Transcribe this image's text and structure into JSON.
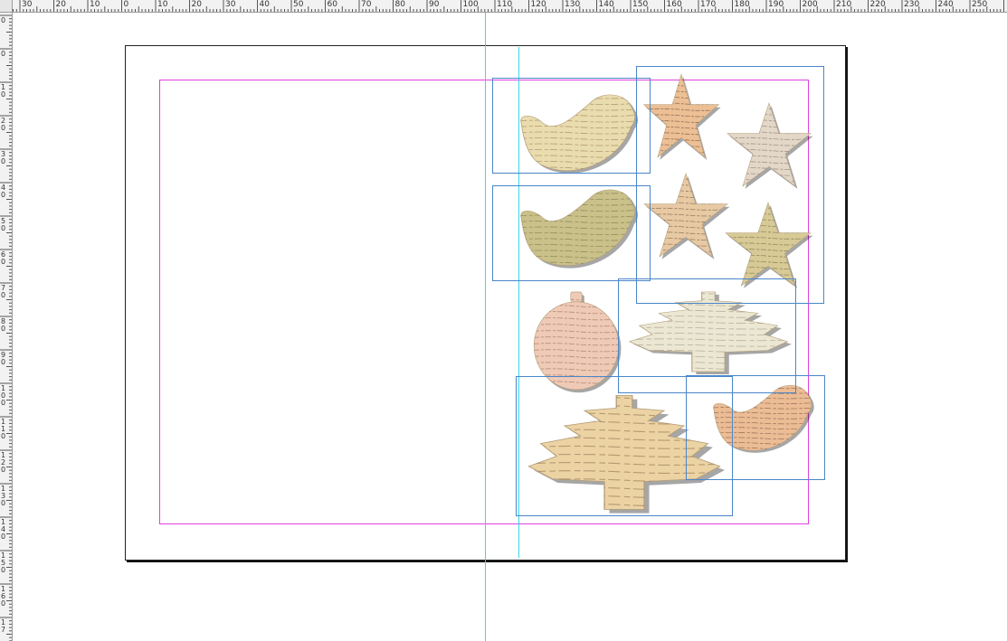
{
  "rulers": {
    "horizontal": {
      "labels": [
        "30",
        "20",
        "10",
        "0",
        "10",
        "20",
        "30",
        "40",
        "50",
        "60",
        "70",
        "80",
        "90",
        "100",
        "110",
        "120",
        "130",
        "140",
        "150",
        "160",
        "170",
        "180",
        "190",
        "200",
        "210",
        "220",
        "230",
        "240",
        "250"
      ]
    },
    "vertical": {
      "labels": [
        "0",
        "0",
        "10",
        "20",
        "30",
        "40",
        "50",
        "60",
        "70",
        "80",
        "90",
        "100",
        "110",
        "120",
        "130",
        "140",
        "150",
        "160",
        "17"
      ]
    }
  },
  "ornaments": [
    {
      "name": "bird-ornament-script",
      "shape": "bird",
      "color": "#e9dcae",
      "ink": "#8a6a3a"
    },
    {
      "name": "star-ornament-music",
      "shape": "star",
      "color": "#ecbf95",
      "ink": "#4a3020"
    },
    {
      "name": "star-ornament-letters",
      "shape": "star",
      "color": "#e3d7c8",
      "ink": "#6d5d55"
    },
    {
      "name": "bird-ornament-compass",
      "shape": "bird",
      "color": "#c9c08a",
      "ink": "#6a6535"
    },
    {
      "name": "star-ornament-gothic",
      "shape": "star",
      "color": "#e7c9a3",
      "ink": "#5a4030"
    },
    {
      "name": "star-ornament-compass",
      "shape": "star",
      "color": "#d7ca96",
      "ink": "#5a5530"
    },
    {
      "name": "bauble-ornament-script",
      "shape": "bauble",
      "color": "#efcab6",
      "ink": "#8a6050"
    },
    {
      "name": "tree-ornament-ledger",
      "shape": "tree",
      "color": "#ebe7d3",
      "ink": "#8a8270"
    },
    {
      "name": "tree-ornament-gothic",
      "shape": "tree",
      "color": "#ecd3a4",
      "ink": "#8a6a48"
    },
    {
      "name": "bird-ornament-music",
      "shape": "bird",
      "color": "#ecbc95",
      "ink": "#4a3020"
    }
  ]
}
